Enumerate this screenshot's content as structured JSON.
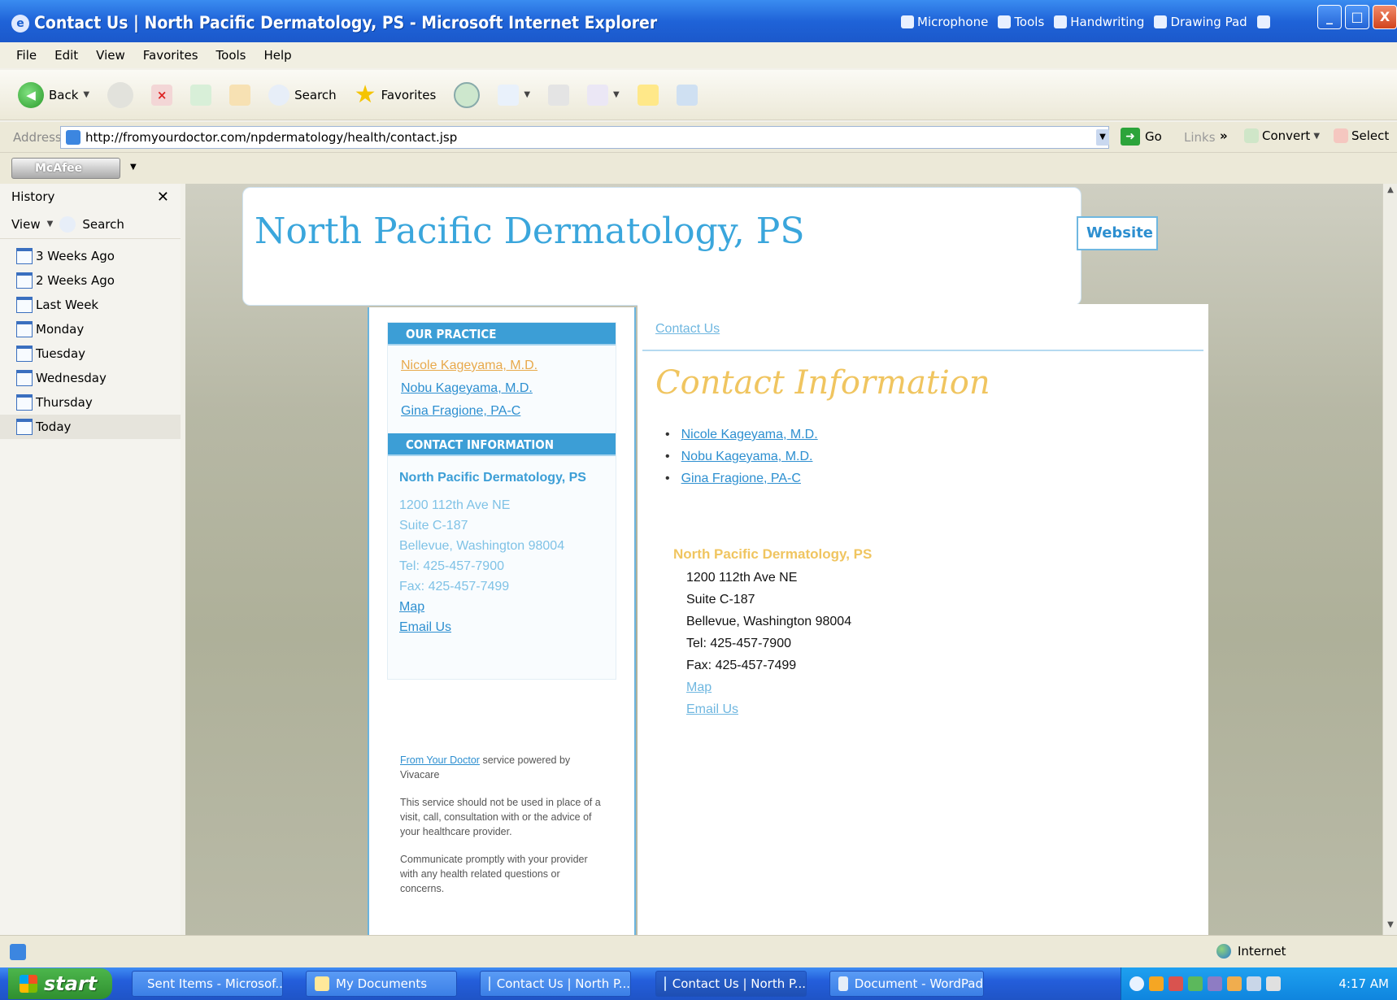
{
  "window": {
    "title": "Contact Us | North Pacific Dermatology, PS - Microsoft Internet Explorer",
    "language_bar": [
      "Microphone",
      "Tools",
      "Handwriting",
      "Drawing Pad"
    ],
    "controls": [
      "_",
      "□",
      "X"
    ]
  },
  "menu": [
    "File",
    "Edit",
    "View",
    "Favorites",
    "Tools",
    "Help"
  ],
  "toolbar": {
    "back_label": "Back",
    "search_label": "Search",
    "favorites_label": "Favorites"
  },
  "address": {
    "label": "Address",
    "url": "http://fromyourdoctor.com/npdermatology/health/contact.jsp",
    "go_label": "Go",
    "links_label": "Links",
    "convert_label": "Convert",
    "select_label": "Select"
  },
  "mcafee": {
    "label": "McAfee"
  },
  "history": {
    "title": "History",
    "view_label": "View",
    "search_label": "Search",
    "items": [
      "3 Weeks Ago",
      "2 Weeks Ago",
      "Last Week",
      "Monday",
      "Tuesday",
      "Wednesday",
      "Thursday",
      "Today"
    ]
  },
  "page": {
    "site_title": "North Pacific Dermatology, PS",
    "website_tab": "Website",
    "sidebar": {
      "practice_heading": "OUR PRACTICE",
      "practice_links": [
        "Nicole Kageyama, M.D.",
        "Nobu Kageyama, M.D.",
        "Gina Fragione, PA-C"
      ],
      "contact_heading": "CONTACT INFORMATION",
      "org": "North Pacific Dermatology, PS",
      "address_lines": [
        "1200 112th Ave NE",
        "Suite C-187",
        "Bellevue, Washington 98004",
        "Tel: 425-457-7900",
        "Fax: 425-457-7499"
      ],
      "map_link": "Map",
      "email_link": "Email Us",
      "disclaimer_link": "From Your Doctor",
      "disclaimer_suffix": "service powered by Vivacare",
      "disclaimer_p2": "This service should not be used in place of a visit, call, consultation with or the advice of your healthcare provider.",
      "disclaimer_p3": "Communicate promptly with your provider with any health related questions or concerns."
    },
    "main": {
      "breadcrumb": "Contact Us",
      "heading": "Contact Information",
      "providers": [
        "Nicole Kageyama, M.D.",
        "Nobu Kageyama, M.D.",
        "Gina Fragione, PA-C"
      ],
      "org": "North Pacific Dermatology, PS",
      "address_lines": [
        "1200 112th Ave NE",
        "Suite C-187",
        "Bellevue, Washington 98004",
        "Tel: 425-457-7900",
        "Fax: 425-457-7499"
      ],
      "map_link": "Map",
      "email_link": "Email Us"
    }
  },
  "status": {
    "zone": "Internet"
  },
  "taskbar": {
    "start_label": "start",
    "tasks": [
      "Sent Items - Microsof...",
      "My Documents",
      "Contact Us | North P...",
      "Contact Us | North P...",
      "Document - WordPad"
    ],
    "clock": "4:17 AM"
  },
  "colors": {
    "title_blue": "#3aa6dc",
    "heading_gold": "#f0c560",
    "link_blue": "#2d8fd0",
    "section_header": "#3c9ed6"
  }
}
